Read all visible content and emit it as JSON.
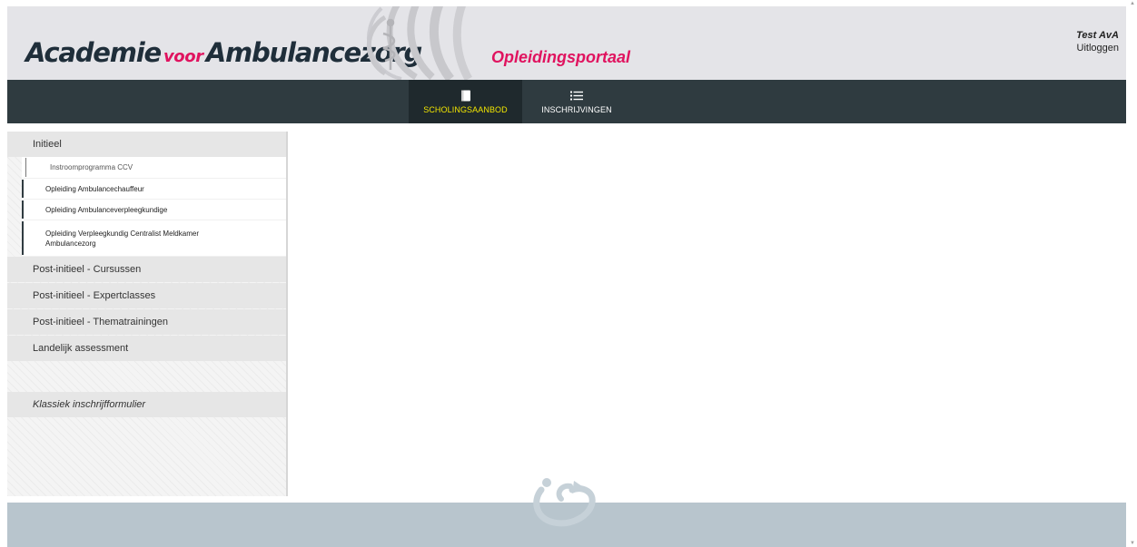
{
  "header": {
    "logo_part1": "Academie",
    "logo_voor": "voor",
    "logo_part2": "Ambulancezorg",
    "portal_title": "Opleidingsportaal",
    "user_name": "Test AvA",
    "logout_label": "Uitloggen"
  },
  "nav": {
    "items": [
      {
        "label": "SCHOLINGSAANBOD",
        "icon": "book-icon",
        "active": true
      },
      {
        "label": "INSCHRIJVINGEN",
        "icon": "list-icon",
        "active": false
      }
    ]
  },
  "sidebar": {
    "categories": [
      {
        "label": "Initieel"
      },
      {
        "label": "Post-initieel - Cursussen"
      },
      {
        "label": "Post-initieel - Expertclasses"
      },
      {
        "label": "Post-initieel - Thematrainingen"
      },
      {
        "label": "Landelijk assessment"
      },
      {
        "label": "Klassiek inschrijfformulier"
      }
    ],
    "subitems": [
      {
        "label": "Instroomprogramma CCV"
      },
      {
        "label": "Opleiding Ambulancechauffeur"
      },
      {
        "label": "Opleiding Ambulanceverpleegkundige"
      },
      {
        "label": "Opleiding Verpleegkundig Centralist Meldkamer Ambulancezorg"
      }
    ]
  },
  "colors": {
    "brand_pink": "#e0135f",
    "nav_dark": "#2f3b40",
    "nav_active_text": "#f2e600",
    "footer": "#b8c5cd"
  }
}
